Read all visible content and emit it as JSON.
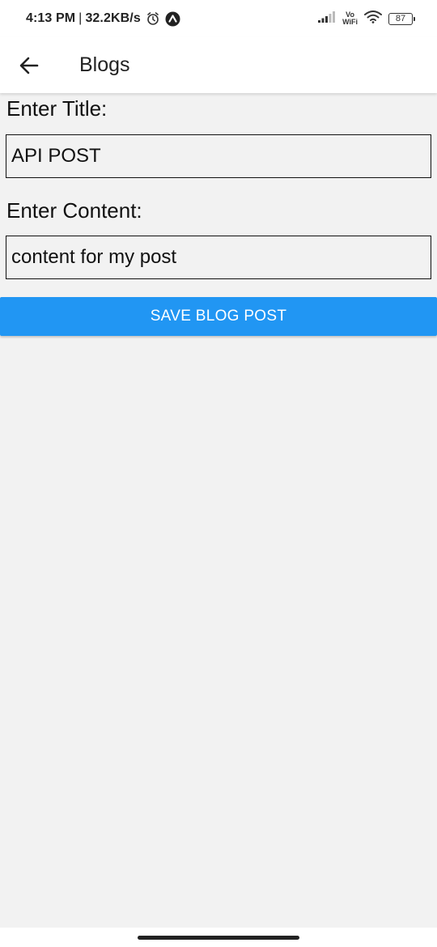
{
  "status_bar": {
    "time": "4:13 PM",
    "separator": "|",
    "speed": "32.2KB/s",
    "alarm_icon": "alarm-icon",
    "app_icon": "arrow-up-circle-icon",
    "signal_icon": "signal-icon",
    "vowifi_top": "Vo",
    "vowifi_bottom": "WiFi",
    "wifi_icon": "wifi-icon",
    "battery": "87"
  },
  "app_bar": {
    "back_icon": "arrow-left-icon",
    "title": "Blogs"
  },
  "form": {
    "title_label": "Enter Title:",
    "title_value": "API POST",
    "content_label": "Enter Content:",
    "content_value": "content for my post",
    "save_label": "SAVE BLOG POST"
  },
  "colors": {
    "accent": "#2196f3",
    "background": "#f2f2f2",
    "bar": "#ffffff"
  }
}
